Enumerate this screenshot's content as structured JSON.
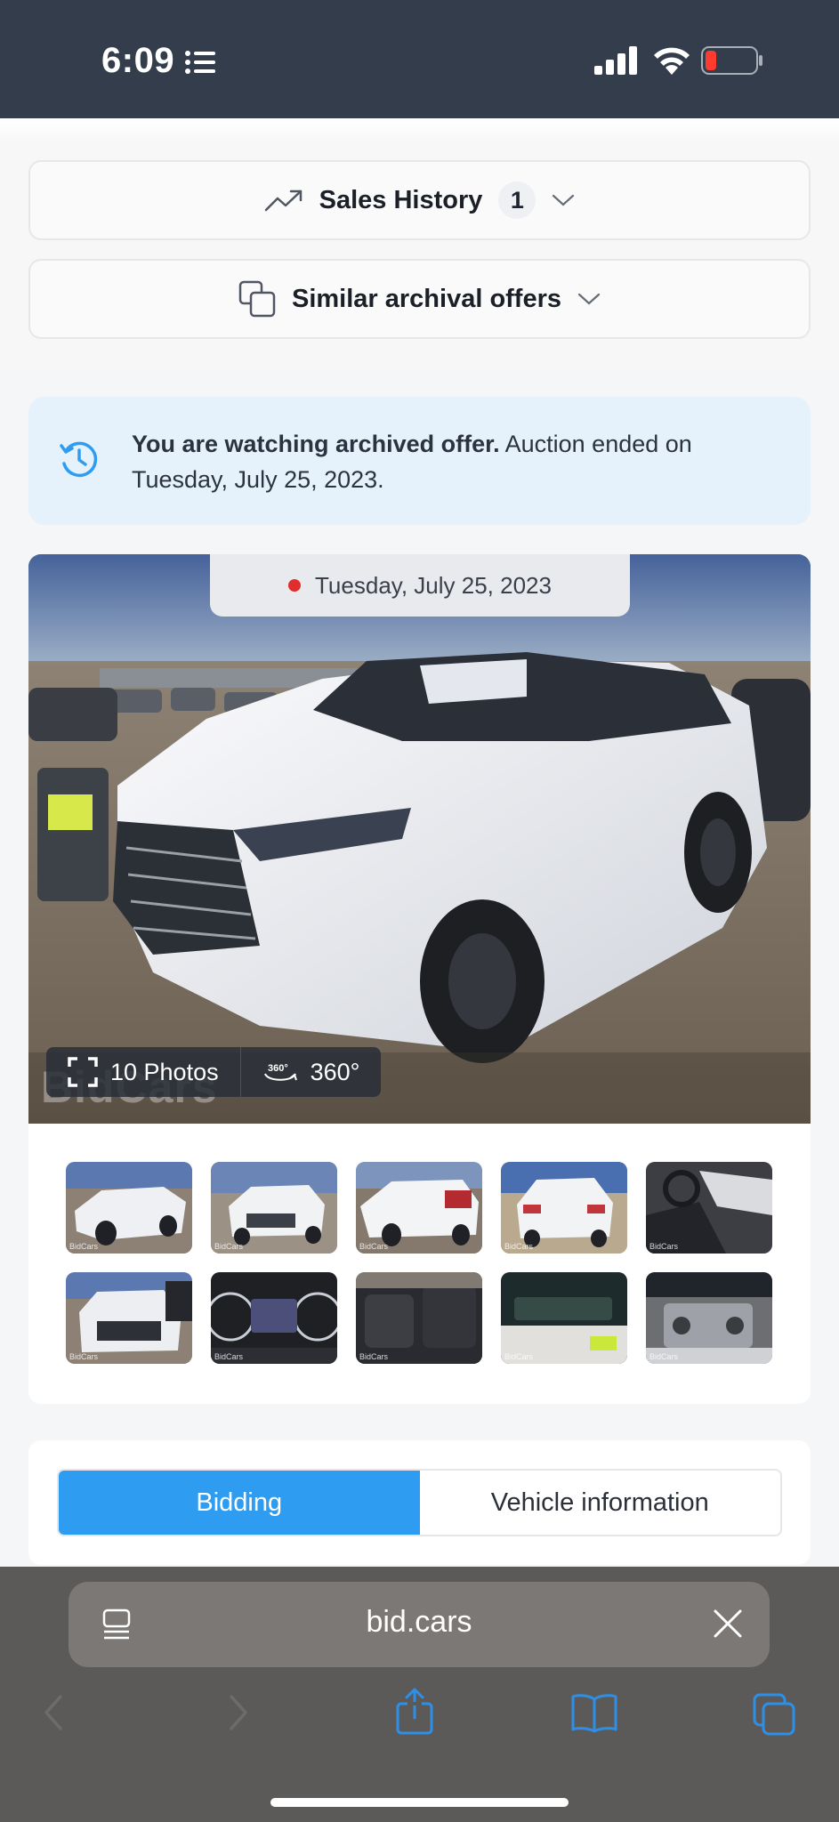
{
  "status_bar": {
    "time": "6:09"
  },
  "accordions": {
    "sales_history": {
      "label": "Sales History",
      "count": "1"
    },
    "similar": {
      "label": "Similar archival offers"
    }
  },
  "notice": {
    "bold": "You are watching archived offer.",
    "text": " Auction ended on Tuesday, July 25, 2023."
  },
  "gallery": {
    "date": "Tuesday, July 25, 2023",
    "photos_label": "10 Photos",
    "view360_label": "360°",
    "watermark": "BidCars",
    "thumbnails": [
      {
        "name": "front-side-view"
      },
      {
        "name": "front-view"
      },
      {
        "name": "rear-side-view"
      },
      {
        "name": "rear-view"
      },
      {
        "name": "interior-front"
      },
      {
        "name": "front-grille-view"
      },
      {
        "name": "instrument-cluster"
      },
      {
        "name": "rear-seats"
      },
      {
        "name": "key-tag"
      },
      {
        "name": "engine-bay"
      }
    ]
  },
  "tabs": {
    "bidding": "Bidding",
    "vehicle_info": "Vehicle information"
  },
  "browser": {
    "url": "bid.cars"
  },
  "colors": {
    "accent": "#2e9cf1",
    "status_bg": "#333d4b",
    "notice_bg": "#e5f2fc"
  }
}
